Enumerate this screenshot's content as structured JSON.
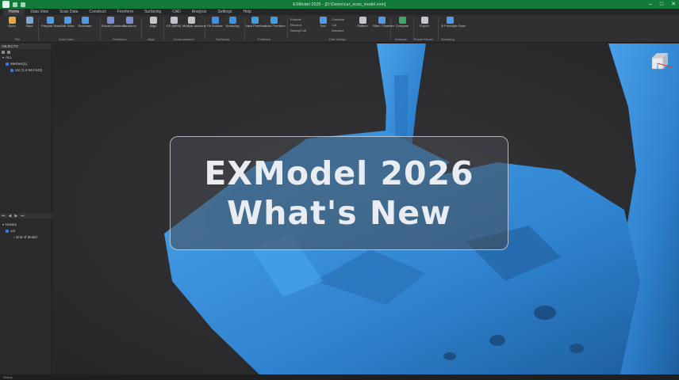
{
  "window": {
    "title": "EXModel 2026 - [D:\\Demo\\car_scan_model.exm]"
  },
  "menu": {
    "tabs": [
      "Home",
      "Data View",
      "Scan Data",
      "Construct",
      "Freeform",
      "Surfacing",
      "CAD",
      "Analysis",
      "Settings",
      "Help"
    ]
  },
  "ribbon": {
    "buttons": [
      {
        "label": "Open",
        "icon": "folder-icon",
        "color": "#e0a93b"
      },
      {
        "label": "Save",
        "icon": "save-icon",
        "color": "#7ea6d8"
      },
      {
        "label": "Prepare Scan",
        "icon": "prepare-scan-icon",
        "color": "#4f9be8"
      },
      {
        "label": "Edit Scan",
        "icon": "edit-scan-icon",
        "color": "#4f9be8"
      },
      {
        "label": "Decimate",
        "icon": "decimate-icon",
        "color": "#4f9be8"
      },
      {
        "label": "Extract primitives",
        "icon": "primitives-icon",
        "color": "#7c8fd6"
      },
      {
        "label": "Construct",
        "icon": "construct-icon",
        "color": "#7c8fd6"
      },
      {
        "label": "Align",
        "icon": "align-icon",
        "color": "#c0c6cc"
      },
      {
        "label": "CS (NEW)",
        "icon": "cross-section-icon",
        "color": "#bfc4ca"
      },
      {
        "label": "Multiple sections",
        "icon": "sections-icon",
        "color": "#bfc4ca"
      },
      {
        "label": "Fit Surface",
        "icon": "fit-surface-icon",
        "color": "#3e8fe6"
      },
      {
        "label": "Surfacing",
        "icon": "surfacing-icon",
        "color": "#3e8fe6"
      },
      {
        "label": "New Freeform",
        "icon": "new-freeform-icon",
        "color": "#3aa0e0"
      },
      {
        "label": "Auto Freeform",
        "icon": "auto-freeform-icon",
        "color": "#3aa0e0"
      },
      {
        "label": "Text",
        "icon": "text-icon",
        "color": "#4f9be8"
      },
      {
        "label": "Pattern",
        "icon": "pattern-icon",
        "color": "#c0c6cc"
      },
      {
        "label": "Fillet / Chamfer",
        "icon": "fillet-icon",
        "color": "#4f9be8"
      },
      {
        "label": "Compare",
        "icon": "compare-icon",
        "color": "#3fa86a"
      },
      {
        "label": "Export",
        "icon": "export-icon",
        "color": "#c0c6cc"
      },
      {
        "label": "3i Freestyle Scan",
        "icon": "scanner-icon",
        "color": "#4f9be8"
      }
    ],
    "small_items": [
      "Extrude",
      "Revolve",
      "Sweep/Loft",
      "Combine",
      "Cut",
      "Intersect"
    ],
    "groups": [
      "File",
      "Scan Data",
      "Primitives",
      "Align",
      "Cross-sections",
      "Surfacing",
      "Freeform",
      "Part Design",
      "Analysis",
      "Export Model",
      "Scanning"
    ]
  },
  "objects_panel": {
    "header": "OBJECTS",
    "tree": [
      {
        "label": "ALL",
        "indent": 0
      },
      {
        "label": "Meshes(1)",
        "indent": 1
      },
      {
        "label": "car (1.4 544 543)",
        "indent": 2
      }
    ]
  },
  "history_panel": {
    "header": "History",
    "tree": [
      {
        "label": "car",
        "indent": 1
      },
      {
        "label": "End of Model",
        "indent": 2
      }
    ]
  },
  "overlay": {
    "line1": "EXModel 2026",
    "line2": "What's New"
  },
  "status": {
    "text": "Ready"
  },
  "colors": {
    "titlebar": "#127a3a",
    "accent": "#2f7de0",
    "mesh_blue": "#3a8fd8"
  }
}
